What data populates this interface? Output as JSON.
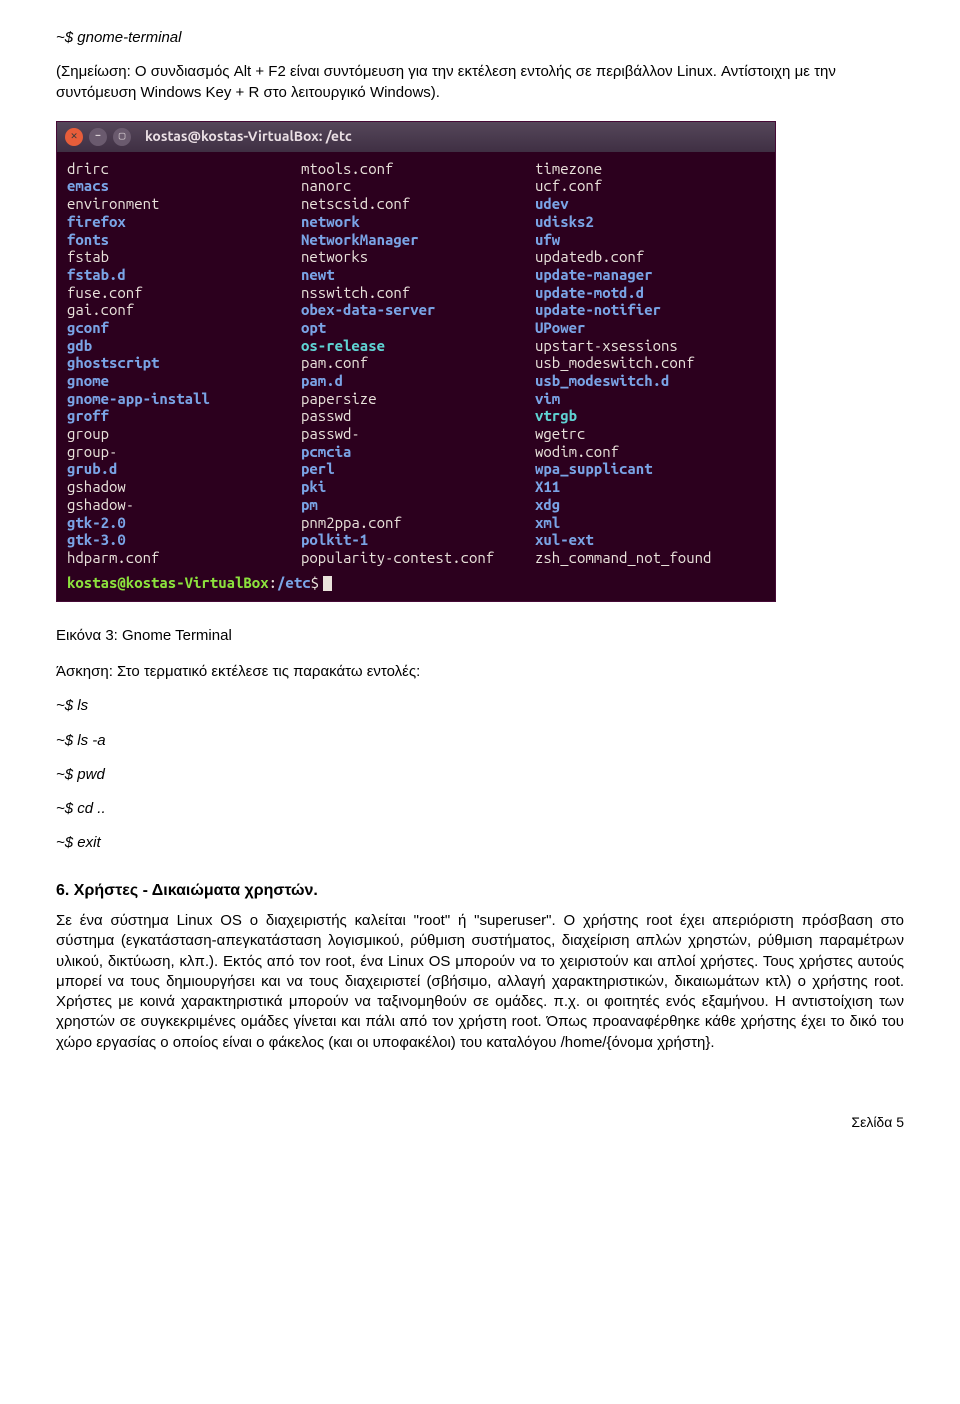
{
  "intro": {
    "command": "~$ gnome-terminal",
    "note": "(Σημείωση: Ο συνδιασμός Alt + F2 είναι συντόμευση για την εκτέλεση εντολής σε περιβάλλον Linux. Αντίστοιχη με την συντόμευση Windows Key + R στο λειτουργικό Windows)."
  },
  "terminal": {
    "title": "kostas@kostas-VirtualBox: /etc",
    "columns": [
      [
        {
          "t": "drirc",
          "c": ""
        },
        {
          "t": "emacs",
          "c": "dir"
        },
        {
          "t": "environment",
          "c": ""
        },
        {
          "t": "firefox",
          "c": "dir"
        },
        {
          "t": "fonts",
          "c": "dir"
        },
        {
          "t": "fstab",
          "c": ""
        },
        {
          "t": "fstab.d",
          "c": "dir"
        },
        {
          "t": "fuse.conf",
          "c": ""
        },
        {
          "t": "gai.conf",
          "c": ""
        },
        {
          "t": "gconf",
          "c": "dir"
        },
        {
          "t": "gdb",
          "c": "dir"
        },
        {
          "t": "ghostscript",
          "c": "dir"
        },
        {
          "t": "gnome",
          "c": "dir"
        },
        {
          "t": "gnome-app-install",
          "c": "dir"
        },
        {
          "t": "groff",
          "c": "dir"
        },
        {
          "t": "group",
          "c": ""
        },
        {
          "t": "group-",
          "c": ""
        },
        {
          "t": "grub.d",
          "c": "dir"
        },
        {
          "t": "gshadow",
          "c": ""
        },
        {
          "t": "gshadow-",
          "c": ""
        },
        {
          "t": "gtk-2.0",
          "c": "dir"
        },
        {
          "t": "gtk-3.0",
          "c": "dir"
        },
        {
          "t": "hdparm.conf",
          "c": ""
        }
      ],
      [
        {
          "t": "mtools.conf",
          "c": ""
        },
        {
          "t": "nanorc",
          "c": ""
        },
        {
          "t": "netscsid.conf",
          "c": ""
        },
        {
          "t": "network",
          "c": "dir"
        },
        {
          "t": "NetworkManager",
          "c": "dir"
        },
        {
          "t": "networks",
          "c": ""
        },
        {
          "t": "newt",
          "c": "dir"
        },
        {
          "t": "nsswitch.conf",
          "c": ""
        },
        {
          "t": "obex-data-server",
          "c": "dir"
        },
        {
          "t": "opt",
          "c": "dir"
        },
        {
          "t": "os-release",
          "c": "lnk"
        },
        {
          "t": "pam.conf",
          "c": ""
        },
        {
          "t": "pam.d",
          "c": "dir"
        },
        {
          "t": "papersize",
          "c": ""
        },
        {
          "t": "passwd",
          "c": ""
        },
        {
          "t": "passwd-",
          "c": ""
        },
        {
          "t": "pcmcia",
          "c": "dir"
        },
        {
          "t": "perl",
          "c": "dir"
        },
        {
          "t": "pki",
          "c": "dir"
        },
        {
          "t": "pm",
          "c": "dir"
        },
        {
          "t": "pnm2ppa.conf",
          "c": ""
        },
        {
          "t": "polkit-1",
          "c": "dir"
        },
        {
          "t": "popularity-contest.conf",
          "c": ""
        }
      ],
      [
        {
          "t": "timezone",
          "c": ""
        },
        {
          "t": "ucf.conf",
          "c": ""
        },
        {
          "t": "udev",
          "c": "dir"
        },
        {
          "t": "udisks2",
          "c": "dir"
        },
        {
          "t": "ufw",
          "c": "dir"
        },
        {
          "t": "updatedb.conf",
          "c": ""
        },
        {
          "t": "update-manager",
          "c": "dir"
        },
        {
          "t": "update-motd.d",
          "c": "dir"
        },
        {
          "t": "update-notifier",
          "c": "dir"
        },
        {
          "t": "UPower",
          "c": "dir"
        },
        {
          "t": "upstart-xsessions",
          "c": ""
        },
        {
          "t": "usb_modeswitch.conf",
          "c": ""
        },
        {
          "t": "usb_modeswitch.d",
          "c": "dir"
        },
        {
          "t": "vim",
          "c": "dir"
        },
        {
          "t": "vtrgb",
          "c": "lnk"
        },
        {
          "t": "wgetrc",
          "c": ""
        },
        {
          "t": "wodim.conf",
          "c": ""
        },
        {
          "t": "wpa_supplicant",
          "c": "dir"
        },
        {
          "t": "X11",
          "c": "dir"
        },
        {
          "t": "xdg",
          "c": "dir"
        },
        {
          "t": "xml",
          "c": "dir"
        },
        {
          "t": "xul-ext",
          "c": "dir"
        },
        {
          "t": "zsh_command_not_found",
          "c": ""
        }
      ]
    ],
    "prompt": {
      "user": "kostas@kostas-VirtualBox",
      "colon": ":",
      "path": "/etc",
      "dollar": "$"
    }
  },
  "caption": "Εικόνα 3: Gnome Terminal",
  "exercise": {
    "label": "Άσκηση: Στο τερματικό εκτέλεσε τις παρακάτω εντολές:",
    "cmds": [
      "~$ ls",
      "~$ ls -a",
      "~$ pwd",
      "~$ cd ..",
      "~$ exit"
    ]
  },
  "section": {
    "heading": "6. Χρήστες - Δικαιώματα χρηστών.",
    "body": "Σε ένα σύστημα Linux OS o διαχειριστής καλείται \"root\" ή \"superuser\".  Ο χρήστης root έχει απεριόριστη πρόσβαση στο σύστημα (εγκατάσταση-απεγκατάσταση λογισμικού, ρύθμιση συστήματος, διαχείριση απλών χρηστών, ρύθμιση παραμέτρων υλικού, δικτύωση, κλπ.). Εκτός από τον root, ένα Linux OS μπορούν να το χειριστούν και απλοί χρήστες. Τους χρήστες αυτούς μπορεί να τους δημιουργήσει και να τους διαχειριστεί (σβήσιμο, αλλαγή χαρακτηριστικών, δικαιωμάτων κτλ) ο χρήστης root. Χρήστες με κοινά χαρακτηριστικά μπορούν να ταξινομηθούν σε ομάδες. π.χ. οι φοιτητές ενός εξαμήνου. Η αντιστοίχιση των χρηστών σε συγκεκριμένες ομάδες γίνεται και πάλι από τον χρήστη root. Όπως προαναφέρθηκε κάθε χρήστης έχει το δικό του χώρο εργασίας ο οποίος είναι ο φάκελος (και οι υποφακέλοι) του καταλόγου /home/{όνομα χρήστη}."
  },
  "page": "Σελίδα 5"
}
